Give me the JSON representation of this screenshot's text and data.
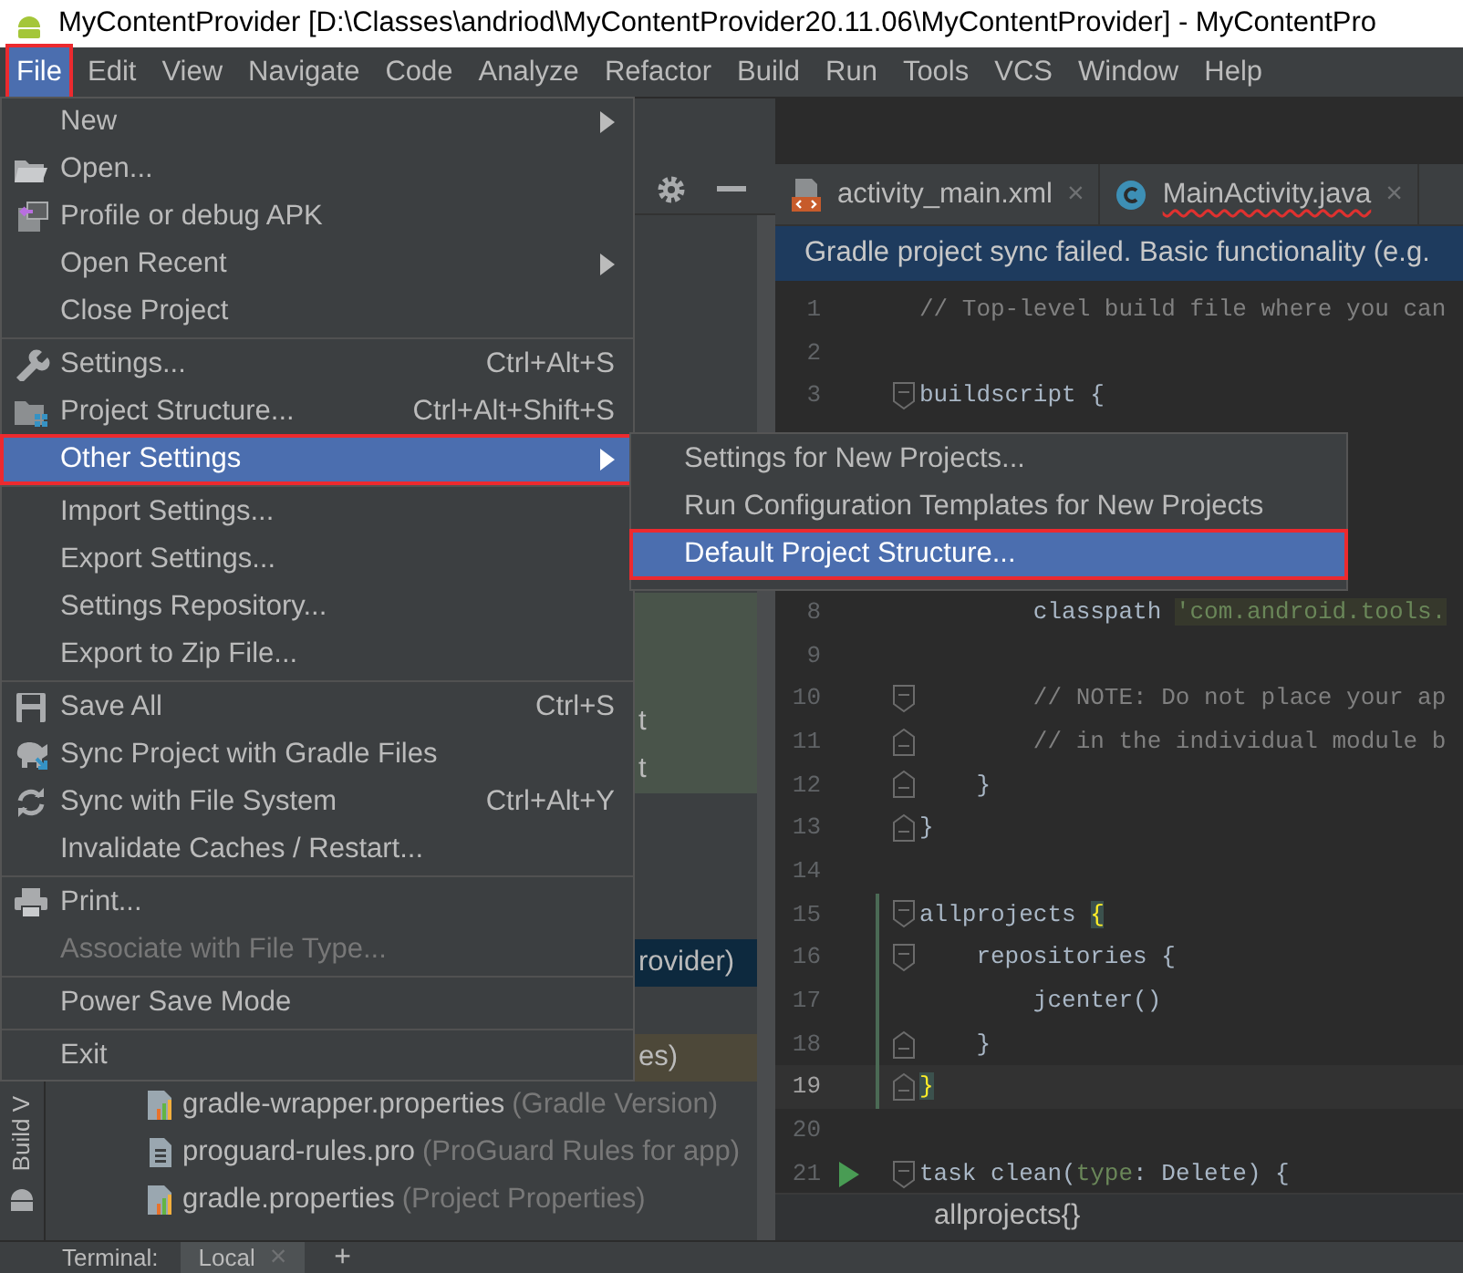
{
  "window": {
    "title": "MyContentProvider [D:\\Classes\\andriod\\MyContentProvider20.11.06\\MyContentProvider] - MyContentPro"
  },
  "menu_bar": [
    {
      "label": "File",
      "selected": true,
      "annotated": true
    },
    {
      "label": "Edit",
      "selected": false,
      "annotated": false
    },
    {
      "label": "View",
      "selected": false,
      "annotated": false
    },
    {
      "label": "Navigate",
      "selected": false,
      "annotated": false
    },
    {
      "label": "Code",
      "selected": false,
      "annotated": false
    },
    {
      "label": "Analyze",
      "selected": false,
      "annotated": false
    },
    {
      "label": "Refactor",
      "selected": false,
      "annotated": false
    },
    {
      "label": "Build",
      "selected": false,
      "annotated": false
    },
    {
      "label": "Run",
      "selected": false,
      "annotated": false
    },
    {
      "label": "Tools",
      "selected": false,
      "annotated": false
    },
    {
      "label": "VCS",
      "selected": false,
      "annotated": false
    },
    {
      "label": "Window",
      "selected": false,
      "annotated": false
    },
    {
      "label": "Help",
      "selected": false,
      "annotated": false
    }
  ],
  "file_menu": {
    "groups": [
      {
        "items": [
          {
            "label": "New",
            "submenu": true,
            "selected": false,
            "disabled": false,
            "annotated": false
          },
          {
            "label": "Open...",
            "submenu": false,
            "selected": false,
            "disabled": false,
            "annotated": false
          },
          {
            "label": "Profile or debug APK",
            "submenu": false,
            "selected": false,
            "disabled": false,
            "annotated": false
          },
          {
            "label": "Open Recent",
            "submenu": true,
            "selected": false,
            "disabled": false,
            "annotated": false
          },
          {
            "label": "Close Project",
            "submenu": false,
            "selected": false,
            "disabled": false,
            "annotated": false
          }
        ]
      },
      {
        "items": [
          {
            "label": "Settings...",
            "shortcut": "Ctrl+Alt+S",
            "submenu": false,
            "selected": false,
            "disabled": false,
            "annotated": false
          },
          {
            "label": "Project Structure...",
            "shortcut": "Ctrl+Alt+Shift+S",
            "submenu": false,
            "selected": false,
            "disabled": false,
            "annotated": false
          },
          {
            "label": "Other Settings",
            "submenu": true,
            "selected": true,
            "disabled": false,
            "annotated": true
          }
        ]
      },
      {
        "items": [
          {
            "label": "Import Settings...",
            "submenu": false,
            "selected": false,
            "disabled": false,
            "annotated": false
          },
          {
            "label": "Export Settings...",
            "submenu": false,
            "selected": false,
            "disabled": false,
            "annotated": false
          },
          {
            "label": "Settings Repository...",
            "submenu": false,
            "selected": false,
            "disabled": false,
            "annotated": false
          },
          {
            "label": "Export to Zip File...",
            "submenu": false,
            "selected": false,
            "disabled": false,
            "annotated": false
          }
        ]
      },
      {
        "items": [
          {
            "label": "Save All",
            "shortcut": "Ctrl+S",
            "submenu": false,
            "selected": false,
            "disabled": false,
            "annotated": false
          },
          {
            "label": "Sync Project with Gradle Files",
            "submenu": false,
            "selected": false,
            "disabled": false,
            "annotated": false
          },
          {
            "label": "Sync with File System",
            "shortcut": "Ctrl+Alt+Y",
            "submenu": false,
            "selected": false,
            "disabled": false,
            "annotated": false
          },
          {
            "label": "Invalidate Caches / Restart...",
            "submenu": false,
            "selected": false,
            "disabled": false,
            "annotated": false
          }
        ]
      },
      {
        "items": [
          {
            "label": "Print...",
            "submenu": false,
            "selected": false,
            "disabled": false,
            "annotated": false
          },
          {
            "label": "Associate with File Type...",
            "submenu": false,
            "selected": false,
            "disabled": true,
            "annotated": false
          }
        ]
      },
      {
        "items": [
          {
            "label": "Power Save Mode",
            "submenu": false,
            "selected": false,
            "disabled": false,
            "annotated": false
          }
        ]
      },
      {
        "items": [
          {
            "label": "Exit",
            "submenu": false,
            "selected": false,
            "disabled": false,
            "annotated": false
          }
        ]
      }
    ]
  },
  "other_settings_submenu": [
    {
      "label": "Settings for New Projects...",
      "selected": false,
      "annotated": false
    },
    {
      "label": "Run Configuration Templates for New Projects",
      "selected": false,
      "annotated": false
    },
    {
      "label": "Default Project Structure...",
      "selected": true,
      "annotated": true
    }
  ],
  "project_panel": {
    "rows": [
      {
        "text": "t",
        "color": "#49544a",
        "selected": false
      },
      {
        "text": "t",
        "color": "#49544a",
        "selected": false
      },
      {
        "text": "rovider)",
        "selected": true
      },
      {
        "text": "es)",
        "color": "#4d4839",
        "selected": false
      },
      {
        "kind": "properties",
        "text": "gradle-wrapper.properties",
        "hint": "(Gradle Version)",
        "selected": false
      },
      {
        "kind": "plain",
        "text": "proguard-rules.pro",
        "hint": "(ProGuard Rules for app)",
        "selected": false
      },
      {
        "kind": "properties",
        "text": "gradle.properties",
        "hint": "(Project Properties)",
        "selected": false
      }
    ]
  },
  "side_strip": {
    "label": "Build V"
  },
  "editor": {
    "tabs": [
      {
        "label": "activity_main.xml",
        "kind": "xml",
        "error": false,
        "close": "×"
      },
      {
        "label": "MainActivity.java",
        "kind": "class",
        "error": true,
        "close": "×"
      }
    ],
    "banner": "Gradle project sync failed. Basic functionality (e.g.",
    "lines": [
      {
        "kind": "code",
        "number": "1",
        "parts": [
          {
            "text": "// Top-level build file where you can",
            "kind": "comment"
          }
        ],
        "run": false,
        "current": false,
        "changed": false
      },
      {
        "kind": "code",
        "number": "2",
        "run": false,
        "current": false,
        "changed": false
      },
      {
        "kind": "code",
        "number": "3",
        "fold": {
          "kind": "start"
        },
        "parts": [
          {
            "text": "buildscript {",
            "kind": "plain"
          }
        ],
        "run": false,
        "current": false,
        "changed": false
      },
      {
        "kind": "covered"
      },
      {
        "kind": "covered"
      },
      {
        "kind": "covered"
      },
      {
        "kind": "covered"
      },
      {
        "kind": "code",
        "number": "8",
        "parts": [
          {
            "text": "        classpath ",
            "kind": "plain"
          },
          {
            "text": "'com.android.tools.",
            "kind": "string"
          }
        ],
        "run": false,
        "current": false,
        "changed": false
      },
      {
        "kind": "code",
        "number": "9",
        "run": false,
        "current": false,
        "changed": false
      },
      {
        "kind": "code",
        "number": "10",
        "fold": {
          "kind": "start"
        },
        "parts": [
          {
            "text": "        // NOTE: Do not place your ap",
            "kind": "comment"
          }
        ],
        "run": false,
        "current": false,
        "changed": false
      },
      {
        "kind": "code",
        "number": "11",
        "fold": {
          "kind": "end"
        },
        "parts": [
          {
            "text": "        // in the individual module b",
            "kind": "comment"
          }
        ],
        "run": false,
        "current": false,
        "changed": false
      },
      {
        "kind": "code",
        "number": "12",
        "fold": {
          "kind": "end"
        },
        "parts": [
          {
            "text": "    }",
            "kind": "plain"
          }
        ],
        "run": false,
        "current": false,
        "changed": false
      },
      {
        "kind": "code",
        "number": "13",
        "fold": {
          "kind": "end"
        },
        "parts": [
          {
            "text": "}",
            "kind": "plain"
          }
        ],
        "run": false,
        "current": false,
        "changed": false
      },
      {
        "kind": "code",
        "number": "14",
        "run": false,
        "current": false,
        "changed": false
      },
      {
        "kind": "code",
        "number": "15",
        "fold": {
          "kind": "start"
        },
        "parts": [
          {
            "text": "allprojects ",
            "kind": "plain"
          },
          {
            "text": "{",
            "kind": "brace"
          }
        ],
        "run": false,
        "current": false,
        "changed": true
      },
      {
        "kind": "code",
        "number": "16",
        "fold": {
          "kind": "start"
        },
        "parts": [
          {
            "text": "    repositories {",
            "kind": "plain"
          }
        ],
        "run": false,
        "current": false,
        "changed": true
      },
      {
        "kind": "code",
        "number": "17",
        "parts": [
          {
            "text": "        jcenter()",
            "kind": "plain"
          }
        ],
        "run": false,
        "current": false,
        "changed": true
      },
      {
        "kind": "code",
        "number": "18",
        "fold": {
          "kind": "end"
        },
        "parts": [
          {
            "text": "    }",
            "kind": "plain"
          }
        ],
        "run": false,
        "current": false,
        "changed": true
      },
      {
        "kind": "code",
        "number": "19",
        "fold": {
          "kind": "end"
        },
        "parts": [
          {
            "text": "}",
            "kind": "brace"
          }
        ],
        "run": false,
        "current": true,
        "changed": true
      },
      {
        "kind": "code",
        "number": "20",
        "run": false,
        "current": false,
        "changed": false
      },
      {
        "kind": "code",
        "number": "21",
        "fold": {
          "kind": "start"
        },
        "parts": [
          {
            "text": "task clean(",
            "kind": "plain"
          },
          {
            "text": "type",
            "kind": "param"
          },
          {
            "text": ": Delete) {",
            "kind": "plain"
          }
        ],
        "run": true,
        "current": false,
        "changed": false
      }
    ],
    "breadcrumb": "allprojects{}"
  },
  "bottom_bar": {
    "label": "Terminal:",
    "tab": "Local",
    "close": "×",
    "add": "+"
  }
}
